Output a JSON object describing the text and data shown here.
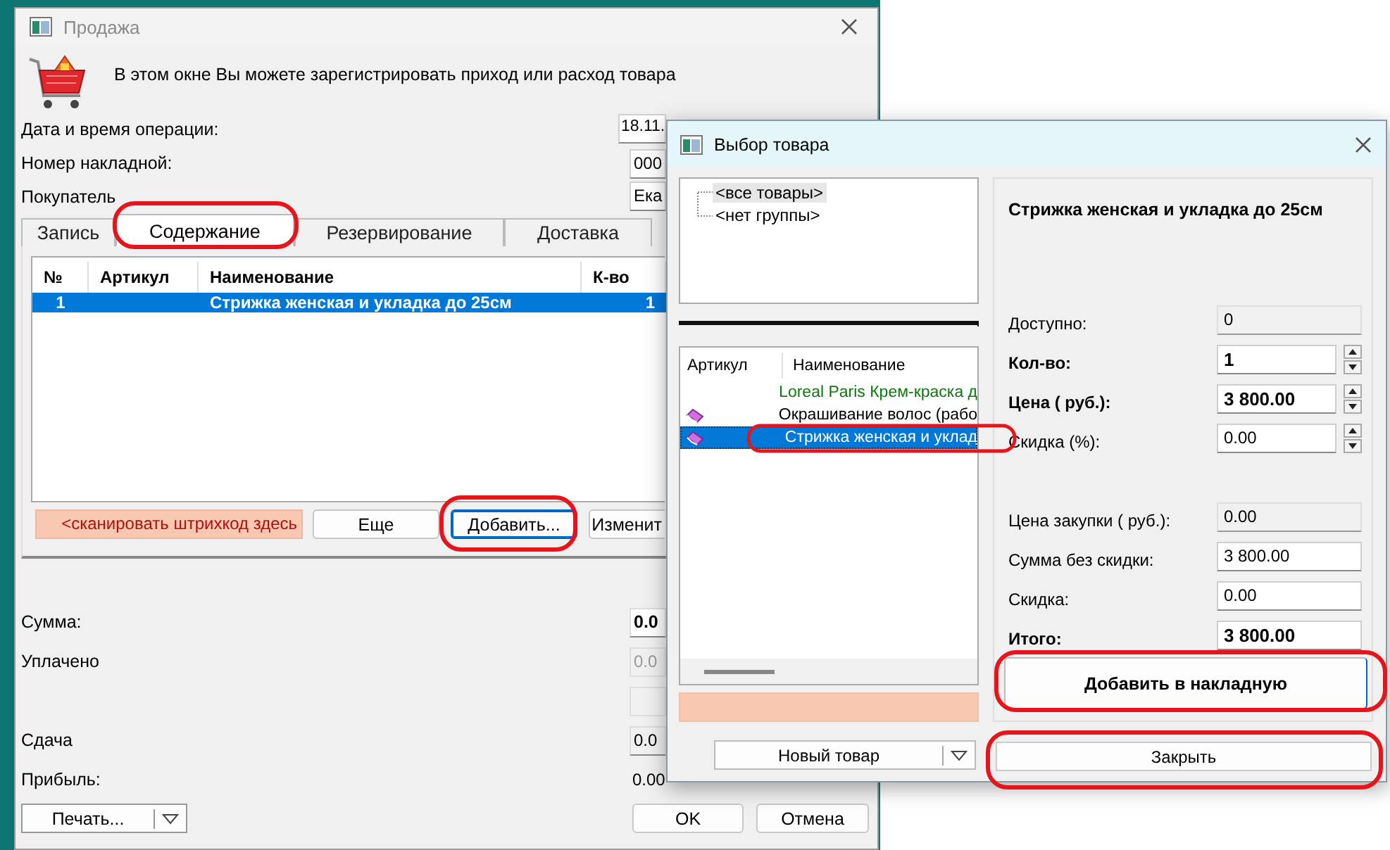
{
  "sale_window": {
    "title": "Продажа",
    "info": "В этом окне Вы можете зарегистрировать приход или расход товара",
    "fields": [
      {
        "label": "Дата и время операции:",
        "value": "18.11."
      },
      {
        "label": "Номер накладной:",
        "value": "000"
      },
      {
        "label": "Покупатель",
        "value": "Ека"
      }
    ],
    "tabs": [
      {
        "label": "Запись",
        "selected": false
      },
      {
        "label": "Содержание",
        "selected": true
      },
      {
        "label": "Резервирование",
        "selected": false
      },
      {
        "label": "Доставка",
        "selected": false
      }
    ],
    "table": {
      "columns": [
        "№",
        "Артикул",
        "Наименование",
        "К-во"
      ],
      "rows": [
        {
          "number": "1",
          "name": "Стрижка женская и укладка до 25см",
          "quantity": "1",
          "selected": true
        }
      ]
    },
    "barcode_placeholder": "<сканировать штрихкод здесь",
    "buttons": [
      {
        "label": "Еще",
        "focused": false
      },
      {
        "label": "Добавить...",
        "focused": true
      },
      {
        "label": "Изменит",
        "focused": false
      }
    ],
    "totals": [
      {
        "label": "Сумма:",
        "value": "0.0",
        "kind": "bold"
      },
      {
        "label": "Уплачено",
        "value": "0.0",
        "kind": "disabled"
      },
      {
        "kind": "blank"
      },
      {
        "label": "Сдача",
        "value": "0.0",
        "kind": "field"
      },
      {
        "label": "Прибыль:",
        "value": "0.00",
        "kind": "plain"
      }
    ],
    "print_button": "Печать...",
    "ok_button": "OK",
    "cancel_button": "Отмена"
  },
  "picker_window": {
    "title": "Выбор товара",
    "tree": [
      {
        "label": "<все товары>",
        "selected": true
      },
      {
        "label": "<нет группы>",
        "selected": false
      }
    ],
    "list": {
      "columns": [
        "Артикул",
        "Наименование"
      ],
      "rows": [
        {
          "name": "Loreal Paris Крем-краска д",
          "color": "#0a7a0a",
          "has_icon": false,
          "selected": false
        },
        {
          "name": "Окрашивание волос (рабо",
          "color": "#000000",
          "has_icon": true,
          "selected": false
        },
        {
          "name": "Стрижка женская и уклад",
          "has_icon": true,
          "selected": true
        }
      ]
    },
    "new_item_button": "Новый товар",
    "product_title": "Стрижка женская и укладка до 25см",
    "form": [
      {
        "label": "Доступно:",
        "value": "0",
        "kind": "readonly",
        "bold": false
      },
      {
        "label": "Кол-во:",
        "value": "1",
        "kind": "spin",
        "bold": true
      },
      {
        "label": "Цена ( руб.):",
        "value": "3 800.00",
        "kind": "spin",
        "bold": true
      },
      {
        "label": "Скидка (%):",
        "value": "0.00",
        "kind": "spin",
        "bold": false
      },
      {
        "label": "Цена закупки ( руб.):",
        "value": "0.00",
        "kind": "readonly",
        "bold": false
      },
      {
        "label": "Сумма без скидки:",
        "value": "3 800.00",
        "kind": "field",
        "bold": false
      },
      {
        "label": "Скидка:",
        "value": "0.00",
        "kind": "field",
        "bold": false
      },
      {
        "label": "Итого:",
        "value": "3 800.00",
        "kind": "field",
        "bold": true
      }
    ],
    "add_button": "Добавить в накладную",
    "close_button": "Закрыть"
  }
}
